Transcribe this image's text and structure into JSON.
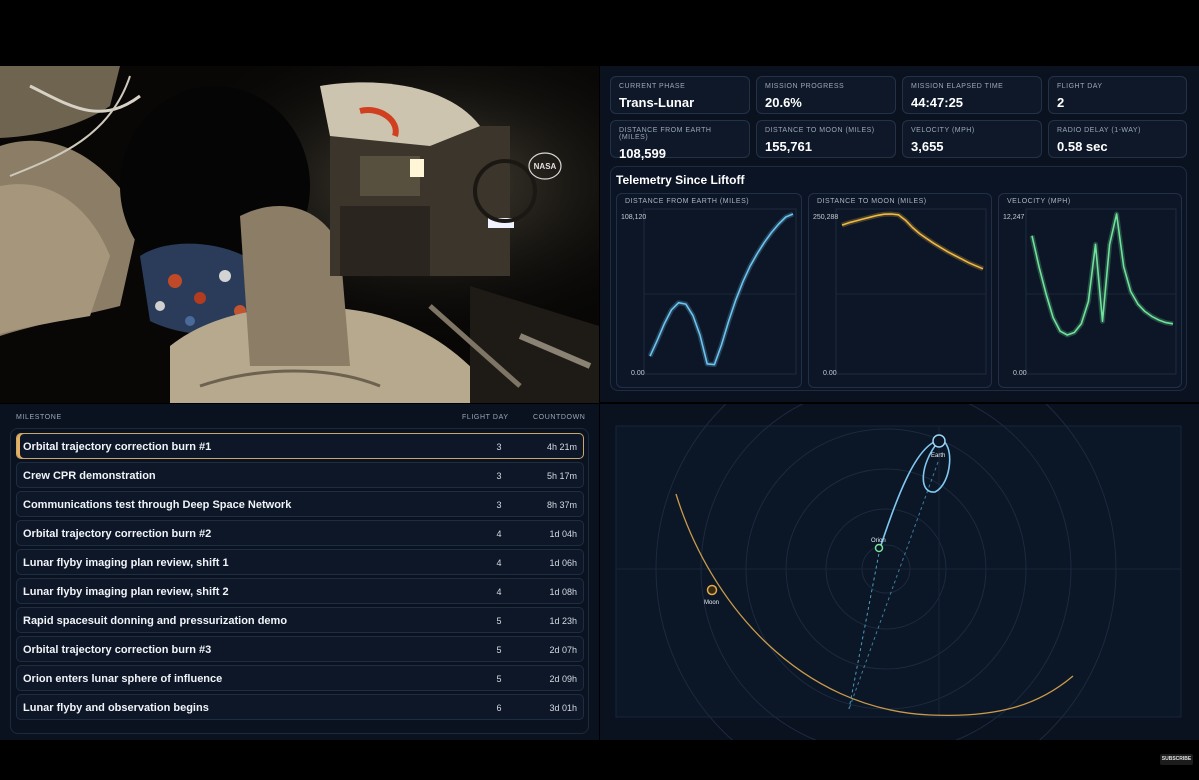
{
  "video": {
    "logo_text": "NASA"
  },
  "stats": [
    {
      "label": "CURRENT PHASE",
      "value": "Trans-Lunar"
    },
    {
      "label": "MISSION PROGRESS",
      "value": "20.6%"
    },
    {
      "label": "MISSION ELAPSED TIME",
      "value": "44:47:25"
    },
    {
      "label": "FLIGHT DAY",
      "value": "2"
    },
    {
      "label": "DISTANCE FROM EARTH (MILES)",
      "value": "108,599"
    },
    {
      "label": "DISTANCE TO MOON (MILES)",
      "value": "155,761"
    },
    {
      "label": "VELOCITY (MPH)",
      "value": "3,655"
    },
    {
      "label": "RADIO DELAY (1-WAY)",
      "value": "0.58 sec"
    }
  ],
  "telemetry": {
    "title": "Telemetry Since Liftoff",
    "charts": [
      {
        "label": "DISTANCE FROM EARTH (MILES)",
        "ymax_label": "108,120",
        "ymin_label": "0.00",
        "color": "#6cc4f0"
      },
      {
        "label": "DISTANCE TO MOON (MILES)",
        "ymax_label": "250,288",
        "ymin_label": "0.00",
        "color": "#f2b941"
      },
      {
        "label": "VELOCITY (MPH)",
        "ymax_label": "12,247",
        "ymin_label": "0.00",
        "color": "#6fe39a"
      }
    ]
  },
  "chart_data": [
    {
      "type": "line",
      "title": "DISTANCE FROM EARTH (MILES)",
      "ylim": [
        0,
        108120
      ],
      "x": [
        0,
        1,
        2,
        3,
        4,
        5,
        6,
        7,
        8,
        9,
        10,
        11,
        12,
        13,
        14,
        15,
        16,
        17,
        18,
        19,
        20
      ],
      "series": [
        {
          "values": [
            7000,
            18000,
            30000,
            40000,
            45000,
            44000,
            36000,
            22000,
            1500,
            1000,
            15000,
            32000,
            47000,
            60000,
            71000,
            80000,
            88000,
            95000,
            101000,
            106000,
            108120
          ]
        }
      ]
    },
    {
      "type": "line",
      "title": "DISTANCE TO MOON (MILES)",
      "ylim": [
        0,
        250288
      ],
      "x": [
        0,
        1,
        2,
        3,
        4,
        5,
        6,
        7,
        8,
        9,
        10,
        11,
        12,
        13,
        14,
        15,
        16,
        17,
        18,
        19,
        20
      ],
      "series": [
        {
          "values": [
            232000,
            236000,
            239000,
            242000,
            245000,
            248000,
            250000,
            250288,
            249000,
            240000,
            228000,
            218000,
            210000,
            202000,
            195000,
            188000,
            182000,
            176000,
            170000,
            165000,
            160000
          ]
        }
      ]
    },
    {
      "type": "line",
      "title": "VELOCITY (MPH)",
      "ylim": [
        0,
        12247
      ],
      "x": [
        0,
        1,
        2,
        3,
        4,
        5,
        6,
        7,
        8,
        9,
        10,
        11,
        12,
        13,
        14,
        15,
        16,
        17,
        18,
        19,
        20
      ],
      "series": [
        {
          "values": [
            10500,
            8000,
            5800,
            3900,
            2800,
            2500,
            2700,
            3400,
            5200,
            9800,
            3600,
            9800,
            12247,
            8000,
            6000,
            5000,
            4400,
            4000,
            3700,
            3500,
            3400
          ]
        }
      ]
    }
  ],
  "milestones": {
    "headers": {
      "name": "MILESTONE",
      "day": "FLIGHT DAY",
      "countdown": "COUNTDOWN"
    },
    "rows": [
      {
        "name": "Orbital trajectory correction burn #1",
        "day": "3",
        "countdown": "4h 21m",
        "active": true
      },
      {
        "name": "Crew CPR demonstration",
        "day": "3",
        "countdown": "5h 17m"
      },
      {
        "name": "Communications test through Deep Space Network",
        "day": "3",
        "countdown": "8h 37m"
      },
      {
        "name": "Orbital trajectory correction burn #2",
        "day": "4",
        "countdown": "1d 04h"
      },
      {
        "name": "Lunar flyby imaging plan review, shift 1",
        "day": "4",
        "countdown": "1d 06h"
      },
      {
        "name": "Lunar flyby imaging plan review, shift 2",
        "day": "4",
        "countdown": "1d 08h"
      },
      {
        "name": "Rapid spacesuit donning and pressurization demo",
        "day": "5",
        "countdown": "1d 23h"
      },
      {
        "name": "Orbital trajectory correction burn #3",
        "day": "5",
        "countdown": "2d 07h"
      },
      {
        "name": "Orion enters lunar sphere of influence",
        "day": "5",
        "countdown": "2d 09h"
      },
      {
        "name": "Lunar flyby and observation begins",
        "day": "6",
        "countdown": "3d 01h"
      }
    ]
  },
  "map": {
    "earth_label": "Earth",
    "orion_label": "Orion",
    "moon_label": "Moon",
    "colors": {
      "trajectory": "#7fc8f2",
      "moon_orbit": "#c99a4a",
      "orion": "#7ce39b"
    }
  },
  "footer": {
    "subscribe_label": "SUBSCRIBE"
  }
}
